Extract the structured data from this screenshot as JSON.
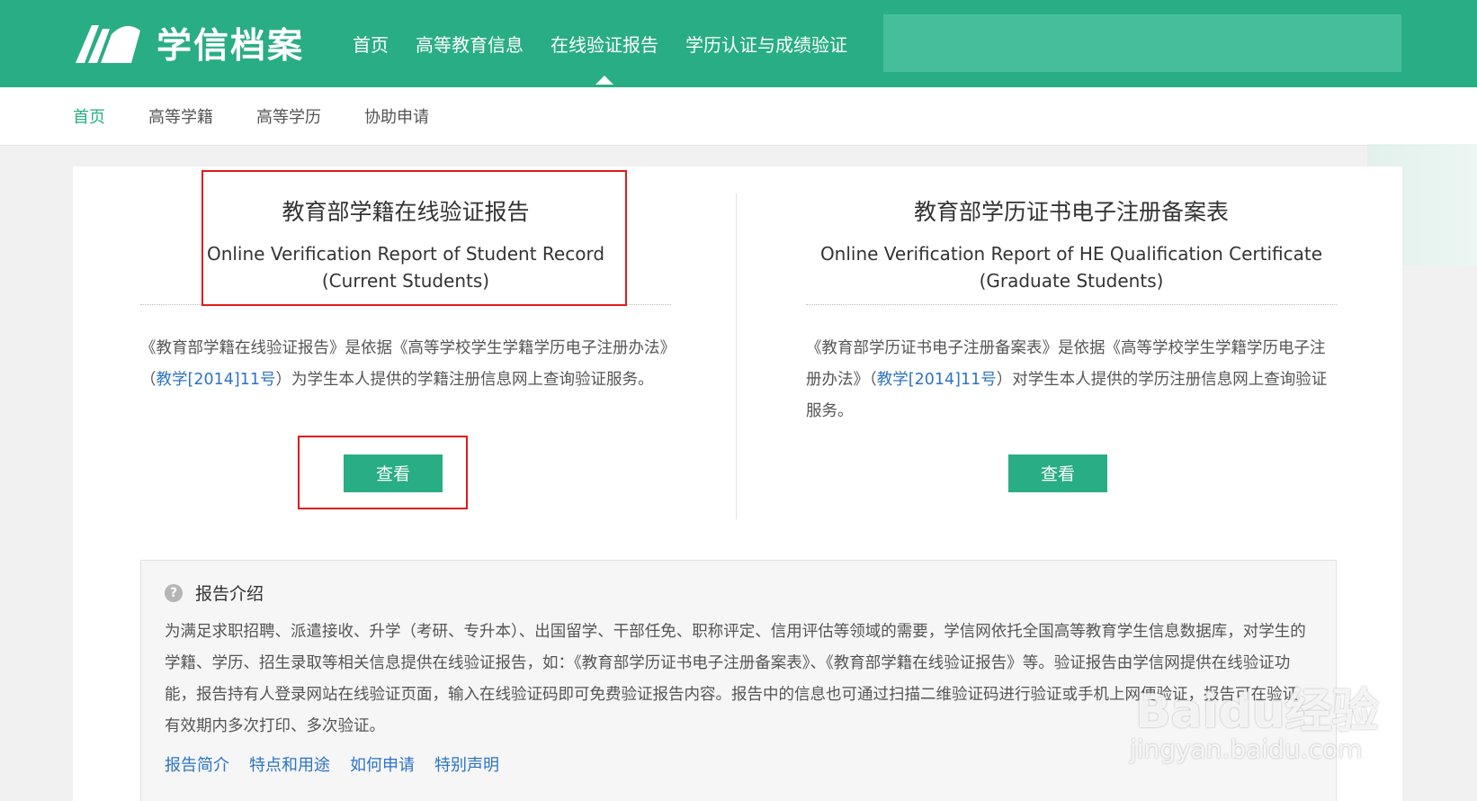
{
  "header": {
    "logo_text": "学信档案",
    "nav": [
      "首页",
      "高等教育信息",
      "在线验证报告",
      "学历认证与成绩验证"
    ],
    "active_nav_index": 2
  },
  "subnav": [
    "首页",
    "高等学籍",
    "高等学历",
    "协助申请"
  ],
  "reports": [
    {
      "title": "教育部学籍在线验证报告",
      "subtitle_line1": "Online Verification Report of Student Record",
      "subtitle_line2": "(Current Students)",
      "desc_before": "《教育部学籍在线验证报告》是依据《高等学校学生学籍学历电子注册办法》（",
      "desc_link": "教学[2014]11号",
      "desc_after": "）为学生本人提供的学籍注册信息网上查询验证服务。",
      "button": "查看"
    },
    {
      "title": "教育部学历证书电子注册备案表",
      "subtitle_line1": "Online Verification Report of HE Qualification Certificate",
      "subtitle_line2": "(Graduate Students)",
      "desc_before": "《教育部学历证书电子注册备案表》是依据《高等学校学生学籍学历电子注册办法》（",
      "desc_link": "教学[2014]11号",
      "desc_after": "）对学生本人提供的学历注册信息网上查询验证服务。",
      "button": "查看"
    }
  ],
  "intro": {
    "icon": "question-circle-icon",
    "title": "报告介绍",
    "body": "为满足求职招聘、派遣接收、升学（考研、专升本）、出国留学、干部任免、职称评定、信用评估等领域的需要，学信网依托全国高等教育学生信息数据库，对学生的学籍、学历、招生录取等相关信息提供在线验证报告，如：《教育部学历证书电子注册备案表》、《教育部学籍在线验证报告》等。验证报告由学信网提供在线验证功能，报告持有人登录网站在线验证页面，输入在线验证码即可免费验证报告内容。报告中的信息也可通过扫描二维验证码进行验证或手机上网便验证，报告可在验证有效期内多次打印、多次验证。",
    "links": [
      "报告简介",
      "特点和用途",
      "如何申请",
      "特别声明"
    ]
  },
  "watermark": {
    "line1": "Baidu经验",
    "line2": "jingyan.baidu.com"
  },
  "colors": {
    "brand": "#29ad84",
    "link": "#2d74c4",
    "highlight": "#e01b1b"
  }
}
